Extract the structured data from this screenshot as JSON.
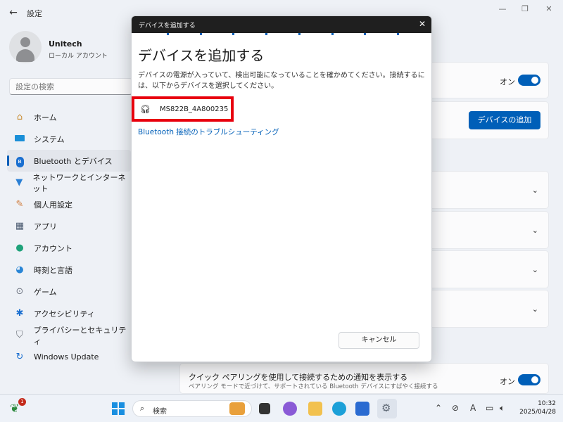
{
  "app": {
    "title": "設定",
    "back_icon": "back-arrow-icon"
  },
  "profile": {
    "name": "Unitech",
    "account_type": "ローカル アカウント"
  },
  "search": {
    "placeholder": "設定の検索"
  },
  "sidebar": {
    "items": [
      {
        "label": "ホーム",
        "icon": "home-icon"
      },
      {
        "label": "システム",
        "icon": "system-icon"
      },
      {
        "label": "Bluetooth とデバイス",
        "icon": "bluetooth-icon",
        "active": true
      },
      {
        "label": "ネットワークとインターネット",
        "icon": "wifi-icon"
      },
      {
        "label": "個人用設定",
        "icon": "brush-icon"
      },
      {
        "label": "アプリ",
        "icon": "apps-icon"
      },
      {
        "label": "アカウント",
        "icon": "account-icon"
      },
      {
        "label": "時刻と言語",
        "icon": "globe-icon"
      },
      {
        "label": "ゲーム",
        "icon": "gamepad-icon"
      },
      {
        "label": "アクセシビリティ",
        "icon": "accessibility-icon"
      },
      {
        "label": "プライバシーとセキュリティ",
        "icon": "shield-icon"
      },
      {
        "label": "Windows Update",
        "icon": "update-icon"
      }
    ]
  },
  "main": {
    "bluetooth_toggle": {
      "state_label": "オン"
    },
    "add_device_button": "デバイスの追加",
    "quick_pairing": {
      "title": "クイック ペアリングを使用して接続するための通知を表示する",
      "subtitle": "ペアリング モードで近づけて、サポートされている Bluetooth デバイスにすばやく接続する",
      "state_label": "オン"
    }
  },
  "dialog": {
    "window_title": "デバイスを追加する",
    "heading": "デバイスを追加する",
    "description": "デバイスの電源が入っていて、検出可能になっていることを確かめてください。接続するには、以下からデバイスを選択してください。",
    "devices": [
      {
        "name": "MS822B_4A800235",
        "icon": "headset-icon"
      }
    ],
    "troubleshoot_link": "Bluetooth 接続のトラブルシューティング",
    "cancel_label": "キャンセル",
    "highlight_color": "#e8000d"
  },
  "taskbar": {
    "search_label": "検索",
    "notification_count": "1",
    "time": "10:32",
    "date": "2025/04/28",
    "ime_label": "A"
  },
  "colors": {
    "accent": "#005fb8",
    "background": "#eef1f6"
  }
}
